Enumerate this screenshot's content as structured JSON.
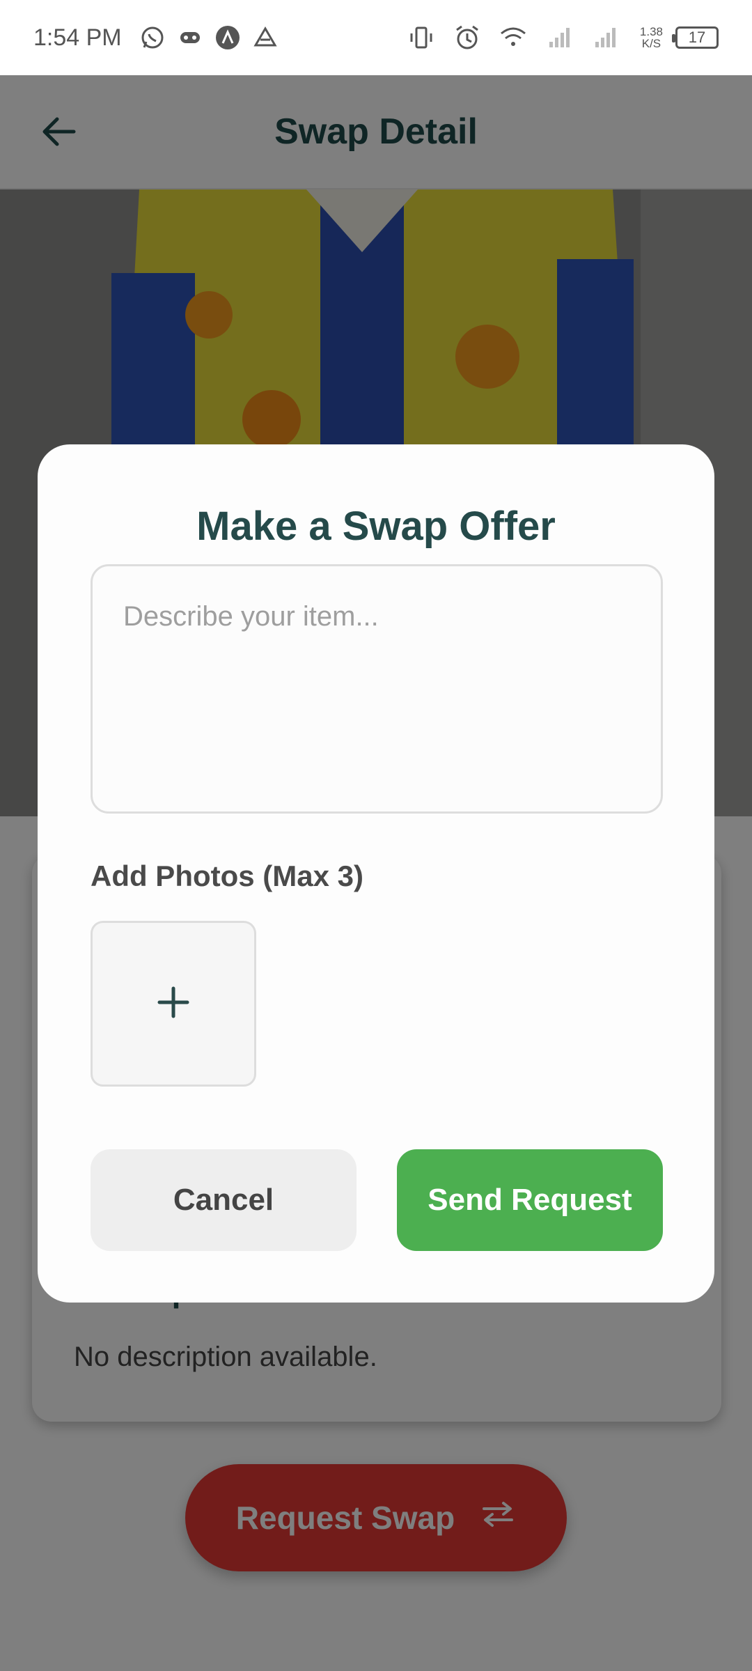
{
  "status_bar": {
    "time": "1:54 PM",
    "net_speed_value": "1.38",
    "net_speed_unit": "K/S",
    "battery": "17"
  },
  "header": {
    "title": "Swap Detail"
  },
  "details": {
    "description_heading": "Description",
    "description_text": "No description available."
  },
  "request_button": {
    "label": "Request Swap"
  },
  "modal": {
    "title": "Make a Swap Offer",
    "description_placeholder": "Describe your item...",
    "description_value": "",
    "photos_label": "Add Photos (Max 3)",
    "add_photo_symbol": "+",
    "cancel_label": "Cancel",
    "send_label": "Send Request"
  },
  "colors": {
    "brand_dark": "#1f4a4a",
    "send_green": "#4caf50",
    "request_red": "#e53935",
    "overlay": "rgba(0,0,0,0.5)"
  }
}
